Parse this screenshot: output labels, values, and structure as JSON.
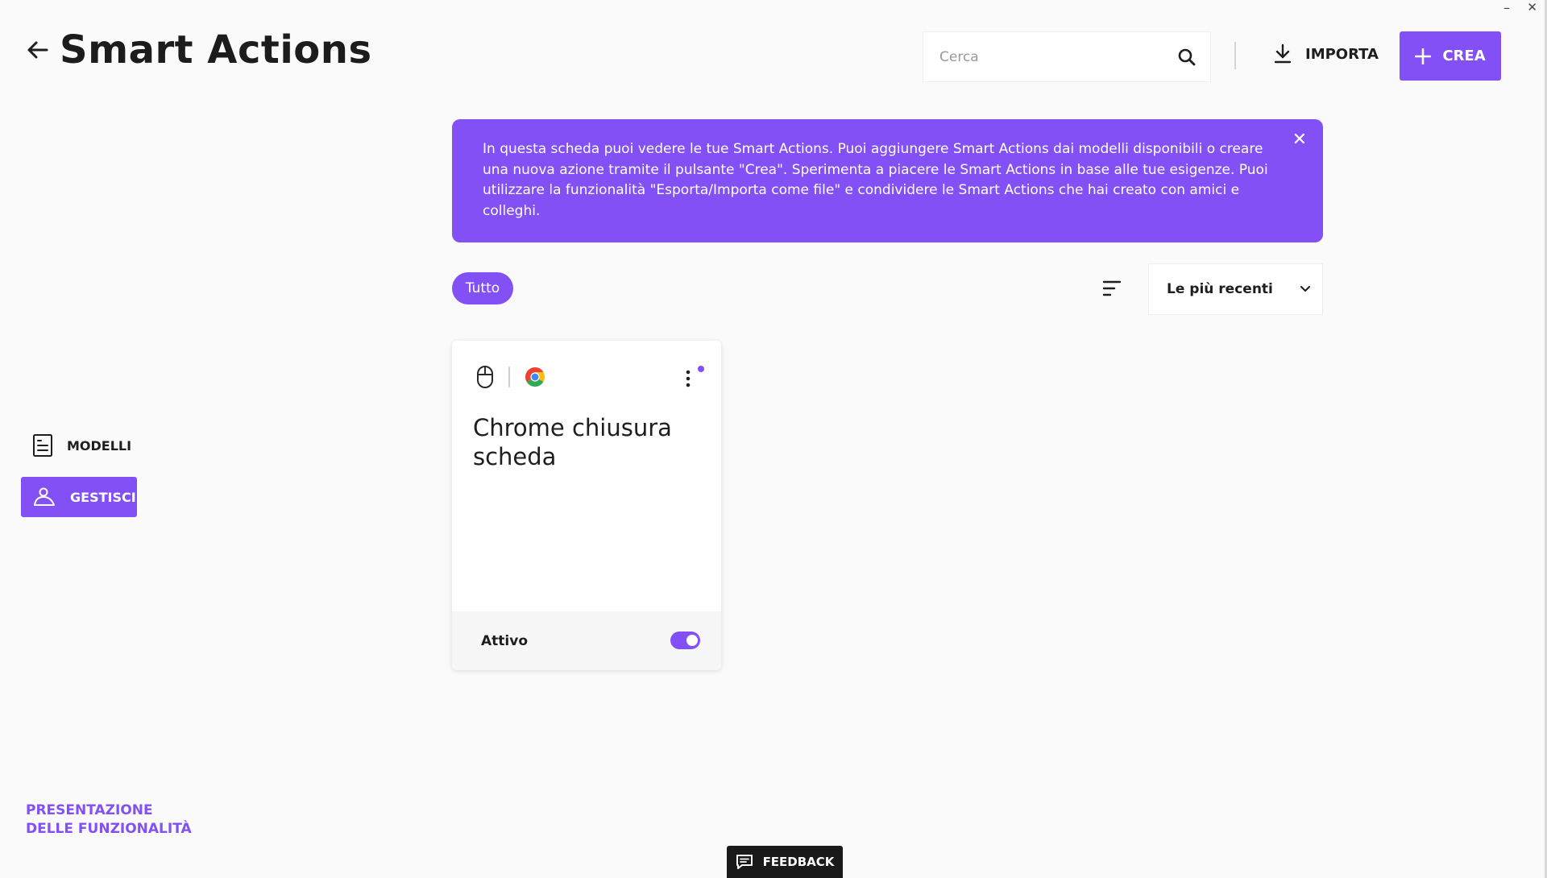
{
  "window": {
    "minimize_glyph": "–",
    "close_glyph": "✕"
  },
  "header": {
    "title": "Smart Actions",
    "back_icon": "arrow-left-icon"
  },
  "search": {
    "placeholder": "Cerca",
    "value": "",
    "icon": "search-icon"
  },
  "toolbar": {
    "import_label": "IMPORTA",
    "create_label": "CREA"
  },
  "banner": {
    "text": "In questa scheda puoi vedere le tue Smart Actions. Puoi aggiungere Smart Actions dai modelli disponibili o creare una nuova azione tramite il pulsante \"Crea\". Sperimenta a piacere le Smart Actions in base alle tue esigenze. Puoi utilizzare la funzionalità \"Esporta/Importa come file\" e condividere le Smart Actions che hai creato con amici e colleghi.",
    "close_glyph": "✕"
  },
  "filters": {
    "active": "Tutto"
  },
  "sort": {
    "selected": "Le più recenti"
  },
  "cards": [
    {
      "title": "Chrome chiusura scheda",
      "trigger_icon": "mouse-icon",
      "app_icon": "chrome-icon",
      "status_label": "Attivo",
      "enabled": true
    }
  ],
  "sidebar": {
    "items": [
      {
        "label": "MODELLI",
        "icon": "templates-icon",
        "active": false
      },
      {
        "label": "GESTISCI",
        "icon": "manage-icon",
        "active": true
      }
    ],
    "tour_link": "PRESENTAZIONE DELLE FUNZIONALITÀ"
  },
  "feedback": {
    "label": "FEEDBACK"
  },
  "colors": {
    "accent": "#8250f5",
    "text": "#1e1e1e",
    "background": "#fafafa"
  }
}
